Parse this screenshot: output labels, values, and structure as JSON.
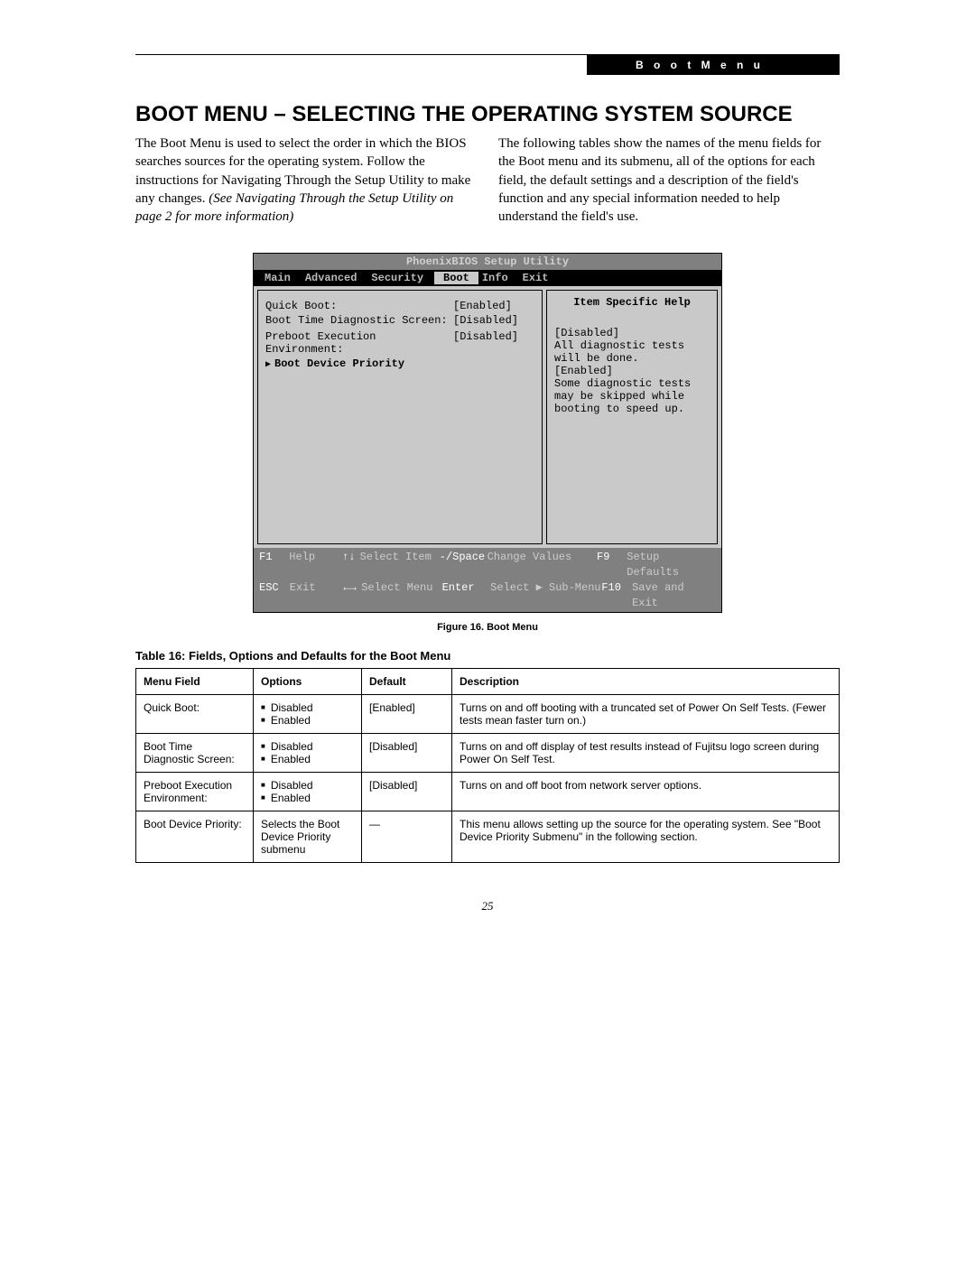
{
  "header": {
    "badge": "B o o t   M e n u"
  },
  "title": "BOOT MENU – SELECTING THE OPERATING SYSTEM SOURCE",
  "intro": {
    "left_a": "The Boot Menu is used to select the order in which the BIOS searches sources for the operating system. Follow the instructions for Navigating Through the Setup Utility to make any changes. ",
    "left_b": "(See Navigating Through the Setup Utility on page 2 for more information)",
    "right": "The following tables show the names of the menu fields for the Boot menu and its submenu, all of the options for each field, the default settings and a description of the field's function and any special information needed to help understand the field's use."
  },
  "bios": {
    "title": "PhoenixBIOS Setup Utility",
    "tabs": [
      "Main",
      "Advanced",
      "Security",
      "Boot",
      "Info",
      "Exit"
    ],
    "active_tab": "Boot",
    "rows": [
      {
        "k": "Quick Boot:",
        "v": "[Enabled]"
      },
      {
        "k": "Boot Time Diagnostic Screen:",
        "v": "[Disabled]"
      },
      {
        "k": "",
        "v": ""
      },
      {
        "k": "Preboot Execution Environment:",
        "v": "[Disabled]"
      }
    ],
    "submenu": "Boot Device Priority",
    "help_title": "Item Specific Help",
    "help_lines": [
      "[Disabled]",
      "All diagnostic tests",
      "will be done.",
      "",
      "[Enabled]",
      "Some diagnostic tests",
      "may be skipped while",
      "booting to speed up."
    ],
    "footer": {
      "f1": "F1",
      "help": "Help",
      "sel_item": "Select Item",
      "chg": "Change Values",
      "f9": "F9",
      "defaults": "Setup Defaults",
      "esc": "ESC",
      "exit": "Exit",
      "sel_menu": "Select Menu",
      "enter": "Enter",
      "sub": "Select ▶ Sub-Menu",
      "f10": "F10",
      "save": "Save and Exit",
      "arr_v": "↑↓",
      "arr_h": "←→",
      "dash": "-/Space"
    }
  },
  "figure_caption": "Figure 16.   Boot Menu",
  "table_title": "Table 16: Fields, Options and Defaults for the Boot Menu",
  "table": {
    "headers": [
      "Menu Field",
      "Options",
      "Default",
      "Description"
    ],
    "rows": [
      {
        "field": "Quick Boot:",
        "opts": [
          "Disabled",
          "Enabled"
        ],
        "def": "[Enabled]",
        "desc": "Turns on and off booting with a truncated set of Power On Self Tests. (Fewer tests mean faster turn on.)"
      },
      {
        "field": "Boot Time Diagnostic Screen:",
        "opts": [
          "Disabled",
          "Enabled"
        ],
        "def": "[Disabled]",
        "desc": "Turns on and off display of test results instead of Fujitsu logo screen during Power On Self Test."
      },
      {
        "field": "Preboot Execution Environment:",
        "opts": [
          "Disabled",
          "Enabled"
        ],
        "def": "[Disabled]",
        "desc": "Turns on and off boot from network server options."
      },
      {
        "field": "Boot Device Priority:",
        "opts_text": "Selects the Boot Device Priority submenu",
        "def": "—",
        "desc": "This menu allows setting up the source for the operating system. See \"Boot Device Priority Submenu\" in the following section."
      }
    ]
  },
  "page_number": "25"
}
